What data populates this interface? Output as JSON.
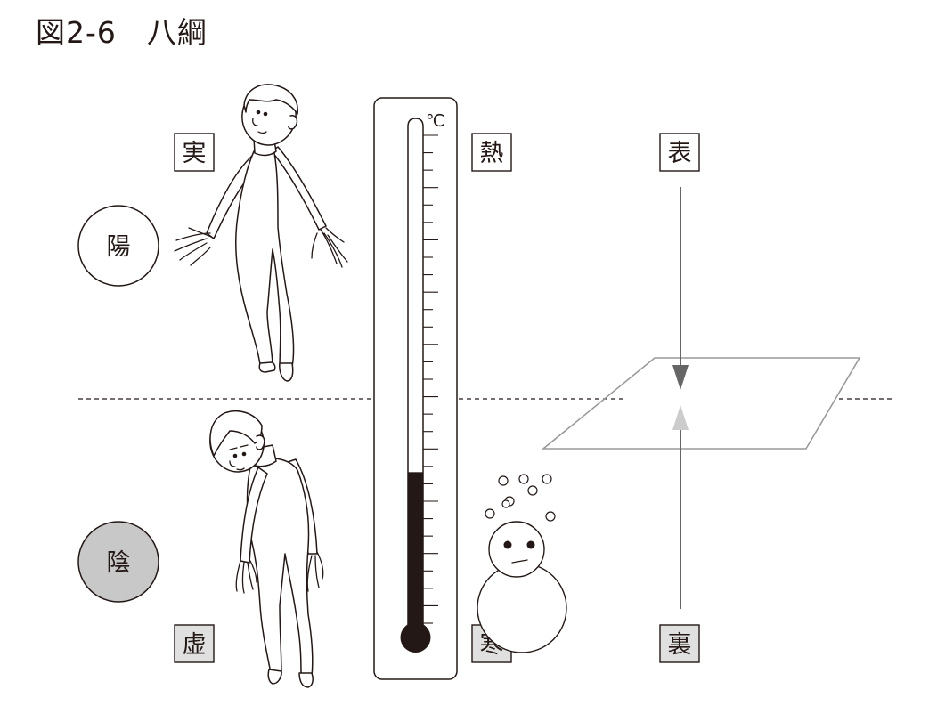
{
  "title": "図2-6　八綱",
  "labels": {
    "jitsu": "実",
    "kyo": "虚",
    "netsu": "熱",
    "kan": "寒",
    "hyo": "表",
    "ri": "裏",
    "yo": "陽",
    "in": "陰",
    "celsius": "℃"
  },
  "thermometer": {
    "level": 0.32
  },
  "colors": {
    "ink": "#231815",
    "box_plain": "#ffffff",
    "box_shaded": "#e0e0e0",
    "yin_circle": "#c8c8c8",
    "arrow_down": "#666666",
    "arrow_up": "#cccccc",
    "plane": "#9a9a9a"
  }
}
